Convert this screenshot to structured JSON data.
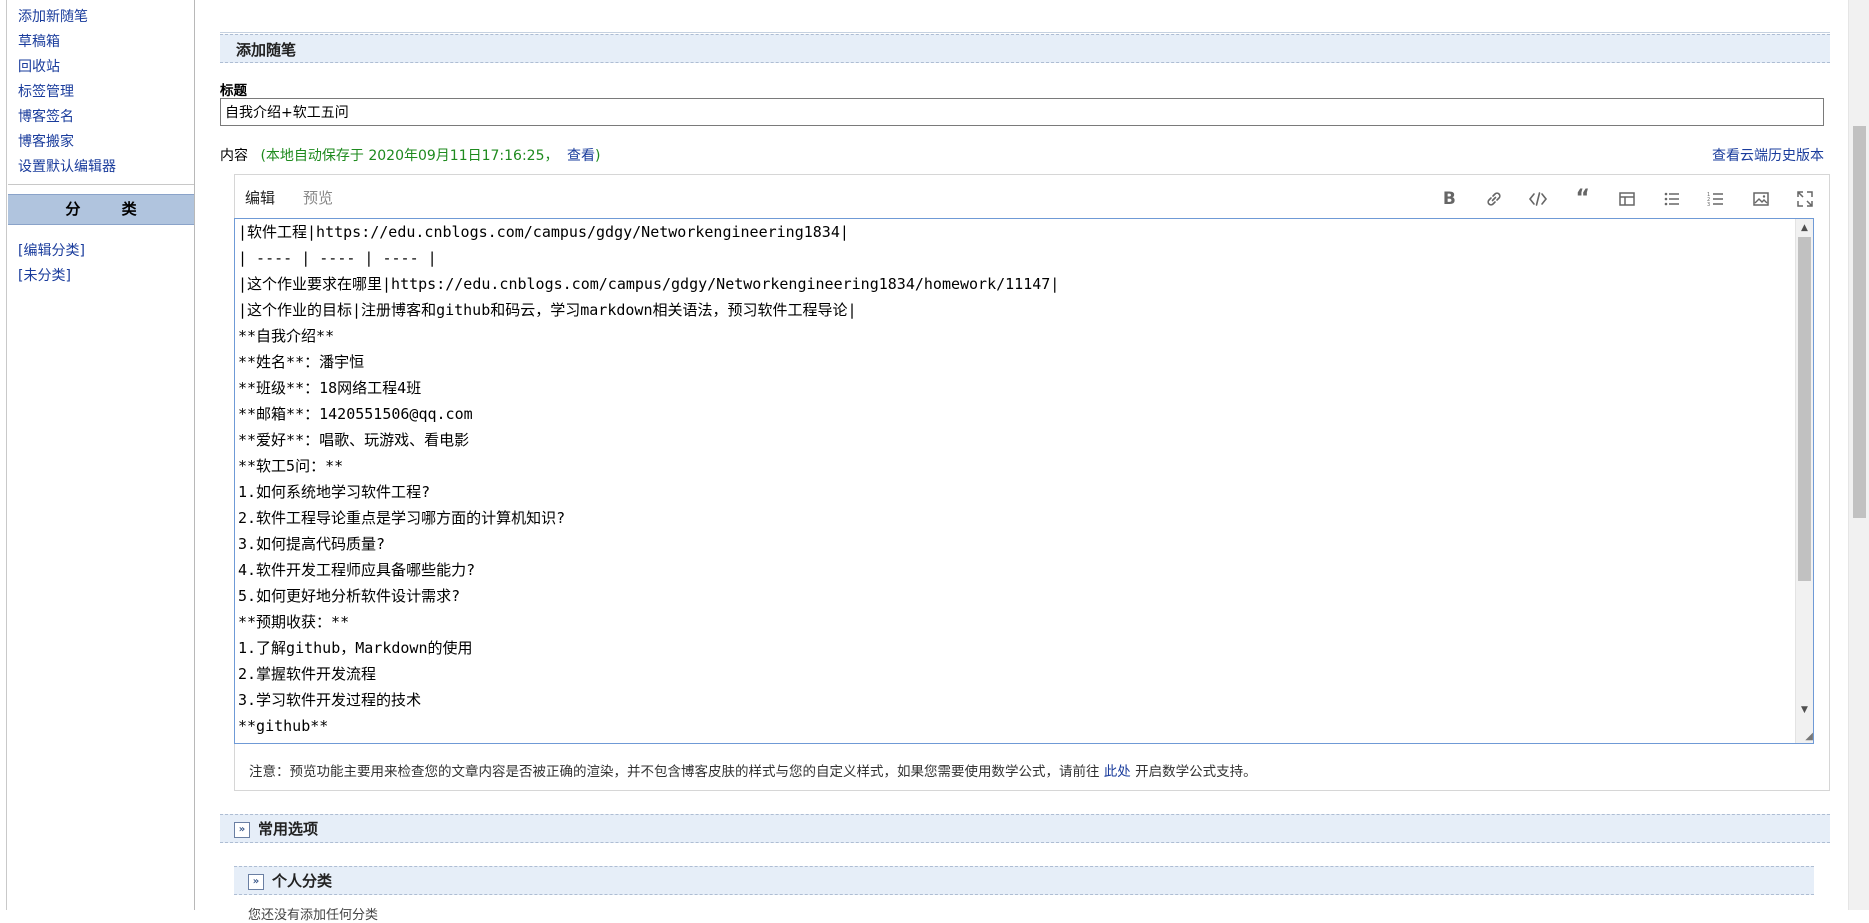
{
  "sidebar": {
    "links": [
      "添加新随笔",
      "草稿箱",
      "回收站",
      "标签管理",
      "博客签名",
      "博客搬家",
      "设置默认编辑器"
    ],
    "category_header": "分 类",
    "category_links": [
      "[编辑分类]",
      "[未分类]"
    ]
  },
  "main": {
    "section_title": "添加随笔",
    "title_label": "标题",
    "title_value": "自我介绍+软工五问",
    "content_label": "内容",
    "autosave_text": "(本地自动保存于 2020年09月11日17:16:25，",
    "autosave_link": "查看",
    "autosave_close": ")",
    "history_link": "查看云端历史版本",
    "tabs": [
      "编辑",
      "预览"
    ],
    "toolbar": [
      "bold-icon",
      "link-icon",
      "code-icon",
      "quote-icon",
      "table-icon",
      "bullet-list-icon",
      "numbered-list-icon",
      "image-icon",
      "fullscreen-icon"
    ],
    "editor_lines": [
      "|软件工程|https://edu.cnblogs.com/campus/gdgy/Networkengineering1834|",
      "| ---- | ---- | ---- |",
      "|这个作业要求在哪里|https://edu.cnblogs.com/campus/gdgy/Networkengineering1834/homework/11147|",
      "|这个作业的目标|注册博客和github和码云，学习markdown相关语法，预习软件工程导论|",
      "**自我介绍**",
      "**姓名**：潘宇恒",
      "**班级**：18网络工程4班",
      "**邮箱**：1420551506@qq.com",
      "**爱好**：唱歌、玩游戏、看电影",
      "**软工5问：**",
      "1.如何系统地学习软件工程?",
      "2.软件工程导论重点是学习哪方面的计算机知识?",
      "3.如何提高代码质量?",
      "4.软件开发工程师应具备哪些能力?",
      "5.如何更好地分析软件设计需求?",
      "**预期收获：**",
      "1.了解github，Markdown的使用",
      "2.掌握软件开发流程",
      "3.学习软件开发过程的技术",
      "**github**"
    ],
    "note_prefix": "注意：预览功能主要用来检查您的文章内容是否被正确的渲染，并不包含博客皮肤的样式与您的自定义样式，如果您需要使用数学公式，请前往",
    "note_link": "此处",
    "note_suffix": "开启数学公式支持。",
    "common_options": "常用选项",
    "personal_category": "个人分类",
    "bottom_text": "您还没有添加任何分类"
  }
}
